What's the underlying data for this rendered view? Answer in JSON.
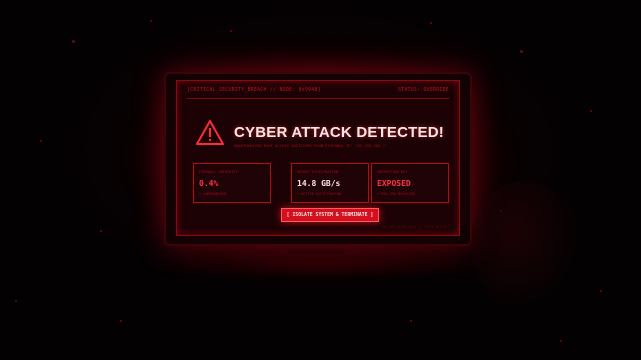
{
  "header": {
    "breach_label": "[CRITICAL_SECURITY_BREACH // NODE: 0x9948]",
    "status_label": "STATUS: OVERRIDE"
  },
  "alert": {
    "title": "CYBER ATTACK DETECTED!",
    "subtitle": "UNAUTHORIZED ROOT ACCESS INITIATED FROM EXTERNAL IP: 192.168.305.7"
  },
  "cards": [
    {
      "label": "FIREWALL INTEGRITY",
      "value": "0.4%",
      "note": "» COMPROMISED"
    },
    {
      "label": "PACKET EXFILTRATION",
      "value": "14.8 GB/s",
      "note": "» ACTIVE EXFILTRATION"
    },
    {
      "label": "ENCRYPTION KEY",
      "value": "EXPOSED",
      "note": "» RSA-256 BYPASSED"
    }
  ],
  "action_button": {
    "label": "[ ISOLATE SYSTEM & TERMINATE ]"
  },
  "footer": {
    "text": "ID: SEC-ALERT-4419 // TRACE ACTIVE"
  },
  "colors": {
    "accent": "#d4101e",
    "value_red": "#ff3344",
    "value_white": "#ffe6e6",
    "background": "#050102"
  },
  "icons": {
    "alert": "warning-triangle-icon"
  }
}
